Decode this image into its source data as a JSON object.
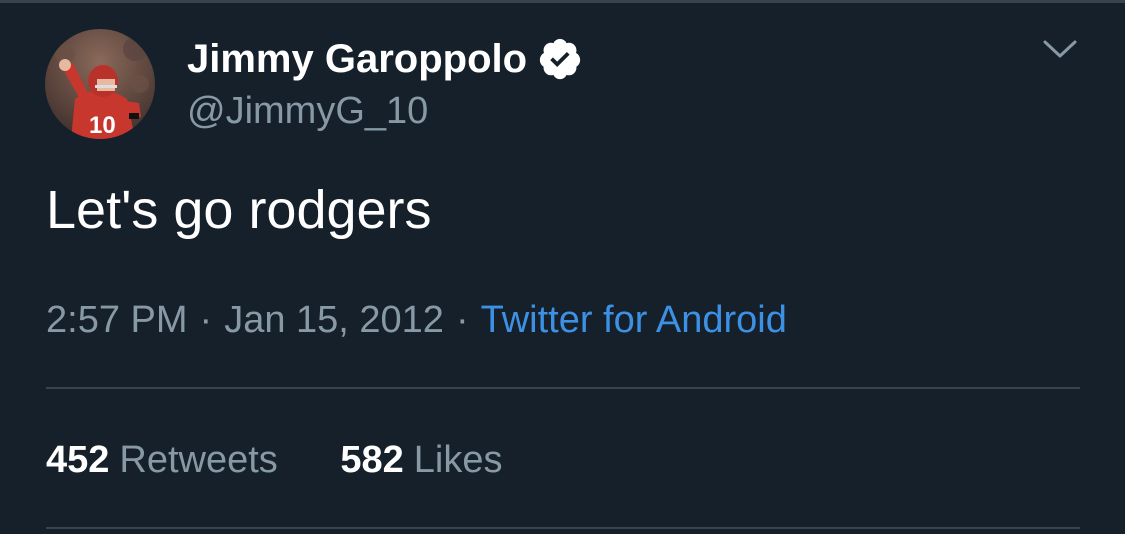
{
  "tweet": {
    "author": {
      "display_name": "Jimmy Garoppolo",
      "handle": "@JimmyG_10",
      "verified": true,
      "avatar_jersey_number": "10"
    },
    "text": "Let's go rodgers",
    "time": "2:57 PM",
    "date": "Jan 15, 2012",
    "separator": "·",
    "source": "Twitter for Android",
    "retweets": {
      "count": "452",
      "label": "Retweets"
    },
    "likes": {
      "count": "582",
      "label": "Likes"
    }
  },
  "icons": {
    "verified": "verified-badge-icon",
    "menu": "chevron-down-icon"
  },
  "colors": {
    "background": "#15202b",
    "secondary_text": "#8899a6",
    "link": "#3d91e4",
    "divider": "#38444d"
  }
}
